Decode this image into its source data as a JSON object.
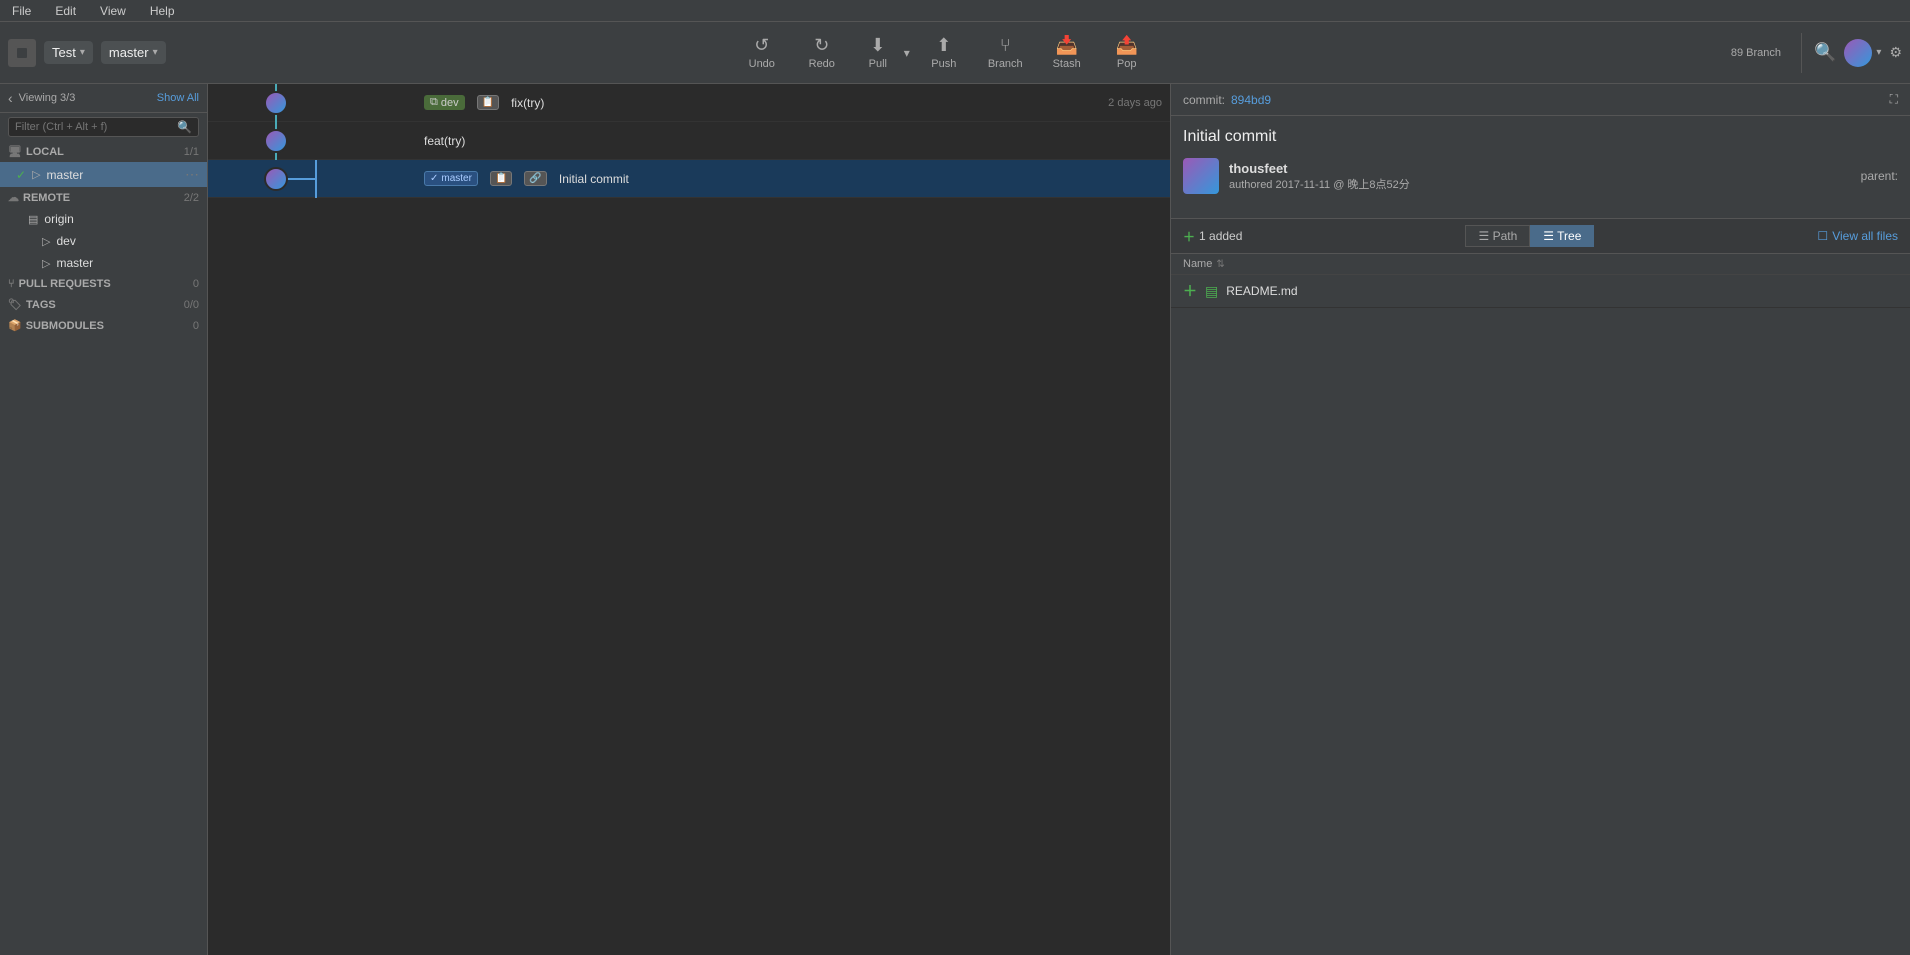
{
  "menubar": {
    "items": [
      "File",
      "Edit",
      "View",
      "Help"
    ]
  },
  "toolbar": {
    "repo_name": "Test",
    "branch_name": "master",
    "undo_label": "Undo",
    "redo_label": "Redo",
    "pull_label": "Pull",
    "push_label": "Push",
    "branch_label": "Branch",
    "stash_label": "Stash",
    "pop_label": "Pop"
  },
  "sidebar": {
    "viewing_text": "Viewing 3/3",
    "show_all_text": "Show All",
    "filter_placeholder": "Filter (Ctrl + Alt + f)",
    "local_label": "LOCAL",
    "local_count": "1/1",
    "master_branch": "master",
    "remote_label": "REMOTE",
    "remote_count": "2/2",
    "origin_label": "origin",
    "origin_dev": "dev",
    "origin_master": "master",
    "pull_requests_label": "PULL REQUESTS",
    "pull_requests_count": "0",
    "tags_label": "TAGS",
    "tags_count": "0/0",
    "submodules_label": "SUBMODULES",
    "submodules_count": "0"
  },
  "commits": [
    {
      "id": "c1",
      "branch_tag": "dev",
      "message": "fix(try)",
      "time": "2 days ago",
      "selected": false,
      "graph_color": "#4aabb8"
    },
    {
      "id": "c2",
      "branch_tag": null,
      "message": "feat(try)",
      "time": "",
      "selected": false,
      "graph_color": "#4aabb8"
    },
    {
      "id": "c3",
      "branch_tag": "master",
      "message": "Initial commit",
      "time": "",
      "selected": true,
      "graph_color": "#4aabb8"
    }
  ],
  "right_panel": {
    "commit_label": "commit:",
    "commit_hash": "894bd9",
    "commit_title": "Initial commit",
    "author_name": "thousfeet",
    "authored_prefix": "authored",
    "author_time": "2017-11-11 @ 晚上8点52分",
    "parent_label": "parent:",
    "files_added_count": "1 added",
    "path_tab": "Path",
    "tree_tab": "Tree",
    "view_all_label": "View all files",
    "name_col": "Name",
    "files": [
      {
        "name": "README.md",
        "status": "added"
      }
    ]
  },
  "branch_count": "89 Branch"
}
